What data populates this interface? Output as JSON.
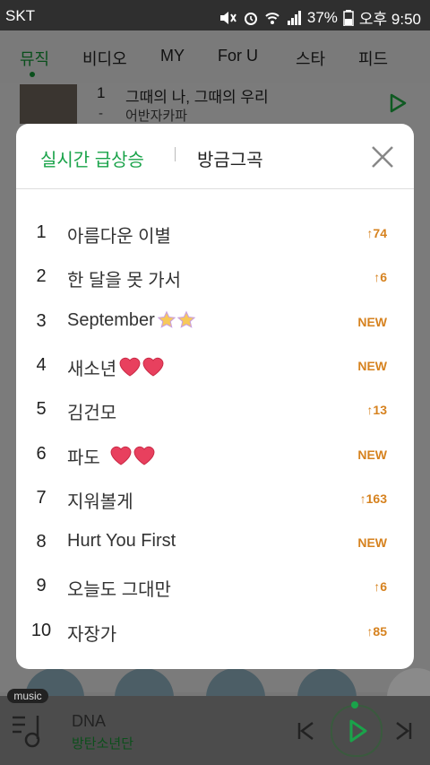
{
  "status_bar": {
    "carrier": "SKT",
    "battery": "37%",
    "time": "오후 9:50"
  },
  "top_nav": {
    "tabs": [
      "뮤직",
      "비디오",
      "MY",
      "For U",
      "스타",
      "피드"
    ],
    "active_index": 0
  },
  "background_chart": {
    "rank": "1",
    "title": "그때의 나, 그때의 우리",
    "change": "-",
    "artist": "어반자카파"
  },
  "modal": {
    "tab_active": "실시간 급상승",
    "tab_other": "방금그곡",
    "accent_color": "#1aa34a",
    "change_color": "#d6821f",
    "items": [
      {
        "rank": "1",
        "title": "아름다운 이별",
        "change": "↑74",
        "deco": ""
      },
      {
        "rank": "2",
        "title": "한 달을 못 가서",
        "change": "↑6",
        "deco": ""
      },
      {
        "rank": "3",
        "title": "September",
        "change": "NEW",
        "deco": "stars"
      },
      {
        "rank": "4",
        "title": "새소년",
        "change": "NEW",
        "deco": "hearts"
      },
      {
        "rank": "5",
        "title": "김건모",
        "change": "↑13",
        "deco": ""
      },
      {
        "rank": "6",
        "title": "파도",
        "change": "NEW",
        "deco": "hearts"
      },
      {
        "rank": "7",
        "title": "지워볼게",
        "change": "↑163",
        "deco": ""
      },
      {
        "rank": "8",
        "title": "Hurt You First",
        "change": "NEW",
        "deco": ""
      },
      {
        "rank": "9",
        "title": "오늘도 그대만",
        "change": "↑6",
        "deco": ""
      },
      {
        "rank": "10",
        "title": "자장가",
        "change": "↑85",
        "deco": ""
      }
    ]
  },
  "mini_player": {
    "badge": "music",
    "song": "DNA",
    "artist": "방탄소년단"
  }
}
